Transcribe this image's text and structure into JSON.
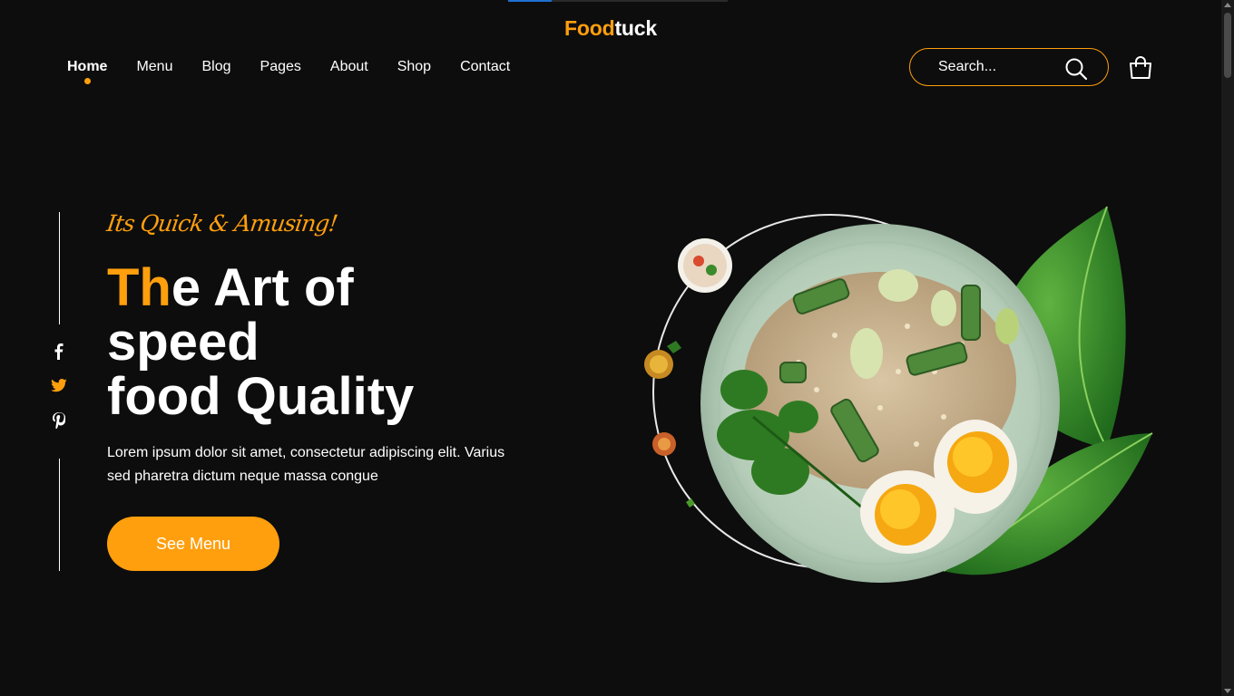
{
  "brand": {
    "part1": "Food",
    "part2": "tuck",
    "accent_color": "#ff9f0d"
  },
  "nav": {
    "items": [
      {
        "label": "Home",
        "active": true
      },
      {
        "label": "Menu"
      },
      {
        "label": "Blog"
      },
      {
        "label": "Pages"
      },
      {
        "label": "About"
      },
      {
        "label": "Shop"
      },
      {
        "label": "Contact"
      }
    ]
  },
  "search": {
    "placeholder": "Search..."
  },
  "icons": {
    "search": "search-icon",
    "cart": "shopping-bag-icon",
    "social": [
      "facebook-icon",
      "twitter-icon",
      "pinterest-icon"
    ]
  },
  "hero": {
    "tagline": "Its Quick & Amusing!",
    "headline_highlight": "Th",
    "headline_line1_rest": "e Art of",
    "headline_line2": "speed",
    "headline_line3": "food Quality",
    "description": "Lorem ipsum dolor sit amet, consectetur adipiscing elit. Varius sed pharetra dictum neque massa congue",
    "cta_label": "See Menu"
  }
}
